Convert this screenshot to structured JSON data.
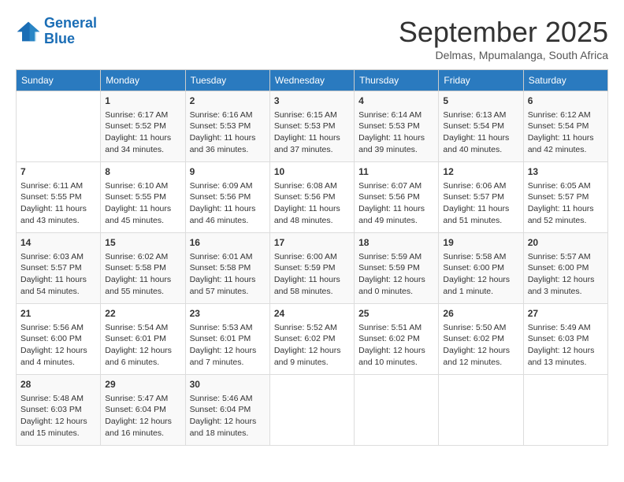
{
  "logo": {
    "line1": "General",
    "line2": "Blue"
  },
  "title": "September 2025",
  "subtitle": "Delmas, Mpumalanga, South Africa",
  "days_of_week": [
    "Sunday",
    "Monday",
    "Tuesday",
    "Wednesday",
    "Thursday",
    "Friday",
    "Saturday"
  ],
  "weeks": [
    [
      {
        "day": "",
        "info": ""
      },
      {
        "day": "1",
        "info": "Sunrise: 6:17 AM\nSunset: 5:52 PM\nDaylight: 11 hours\nand 34 minutes."
      },
      {
        "day": "2",
        "info": "Sunrise: 6:16 AM\nSunset: 5:53 PM\nDaylight: 11 hours\nand 36 minutes."
      },
      {
        "day": "3",
        "info": "Sunrise: 6:15 AM\nSunset: 5:53 PM\nDaylight: 11 hours\nand 37 minutes."
      },
      {
        "day": "4",
        "info": "Sunrise: 6:14 AM\nSunset: 5:53 PM\nDaylight: 11 hours\nand 39 minutes."
      },
      {
        "day": "5",
        "info": "Sunrise: 6:13 AM\nSunset: 5:54 PM\nDaylight: 11 hours\nand 40 minutes."
      },
      {
        "day": "6",
        "info": "Sunrise: 6:12 AM\nSunset: 5:54 PM\nDaylight: 11 hours\nand 42 minutes."
      }
    ],
    [
      {
        "day": "7",
        "info": "Sunrise: 6:11 AM\nSunset: 5:55 PM\nDaylight: 11 hours\nand 43 minutes."
      },
      {
        "day": "8",
        "info": "Sunrise: 6:10 AM\nSunset: 5:55 PM\nDaylight: 11 hours\nand 45 minutes."
      },
      {
        "day": "9",
        "info": "Sunrise: 6:09 AM\nSunset: 5:56 PM\nDaylight: 11 hours\nand 46 minutes."
      },
      {
        "day": "10",
        "info": "Sunrise: 6:08 AM\nSunset: 5:56 PM\nDaylight: 11 hours\nand 48 minutes."
      },
      {
        "day": "11",
        "info": "Sunrise: 6:07 AM\nSunset: 5:56 PM\nDaylight: 11 hours\nand 49 minutes."
      },
      {
        "day": "12",
        "info": "Sunrise: 6:06 AM\nSunset: 5:57 PM\nDaylight: 11 hours\nand 51 minutes."
      },
      {
        "day": "13",
        "info": "Sunrise: 6:05 AM\nSunset: 5:57 PM\nDaylight: 11 hours\nand 52 minutes."
      }
    ],
    [
      {
        "day": "14",
        "info": "Sunrise: 6:03 AM\nSunset: 5:57 PM\nDaylight: 11 hours\nand 54 minutes."
      },
      {
        "day": "15",
        "info": "Sunrise: 6:02 AM\nSunset: 5:58 PM\nDaylight: 11 hours\nand 55 minutes."
      },
      {
        "day": "16",
        "info": "Sunrise: 6:01 AM\nSunset: 5:58 PM\nDaylight: 11 hours\nand 57 minutes."
      },
      {
        "day": "17",
        "info": "Sunrise: 6:00 AM\nSunset: 5:59 PM\nDaylight: 11 hours\nand 58 minutes."
      },
      {
        "day": "18",
        "info": "Sunrise: 5:59 AM\nSunset: 5:59 PM\nDaylight: 12 hours\nand 0 minutes."
      },
      {
        "day": "19",
        "info": "Sunrise: 5:58 AM\nSunset: 6:00 PM\nDaylight: 12 hours\nand 1 minute."
      },
      {
        "day": "20",
        "info": "Sunrise: 5:57 AM\nSunset: 6:00 PM\nDaylight: 12 hours\nand 3 minutes."
      }
    ],
    [
      {
        "day": "21",
        "info": "Sunrise: 5:56 AM\nSunset: 6:00 PM\nDaylight: 12 hours\nand 4 minutes."
      },
      {
        "day": "22",
        "info": "Sunrise: 5:54 AM\nSunset: 6:01 PM\nDaylight: 12 hours\nand 6 minutes."
      },
      {
        "day": "23",
        "info": "Sunrise: 5:53 AM\nSunset: 6:01 PM\nDaylight: 12 hours\nand 7 minutes."
      },
      {
        "day": "24",
        "info": "Sunrise: 5:52 AM\nSunset: 6:02 PM\nDaylight: 12 hours\nand 9 minutes."
      },
      {
        "day": "25",
        "info": "Sunrise: 5:51 AM\nSunset: 6:02 PM\nDaylight: 12 hours\nand 10 minutes."
      },
      {
        "day": "26",
        "info": "Sunrise: 5:50 AM\nSunset: 6:02 PM\nDaylight: 12 hours\nand 12 minutes."
      },
      {
        "day": "27",
        "info": "Sunrise: 5:49 AM\nSunset: 6:03 PM\nDaylight: 12 hours\nand 13 minutes."
      }
    ],
    [
      {
        "day": "28",
        "info": "Sunrise: 5:48 AM\nSunset: 6:03 PM\nDaylight: 12 hours\nand 15 minutes."
      },
      {
        "day": "29",
        "info": "Sunrise: 5:47 AM\nSunset: 6:04 PM\nDaylight: 12 hours\nand 16 minutes."
      },
      {
        "day": "30",
        "info": "Sunrise: 5:46 AM\nSunset: 6:04 PM\nDaylight: 12 hours\nand 18 minutes."
      },
      {
        "day": "",
        "info": ""
      },
      {
        "day": "",
        "info": ""
      },
      {
        "day": "",
        "info": ""
      },
      {
        "day": "",
        "info": ""
      }
    ]
  ]
}
